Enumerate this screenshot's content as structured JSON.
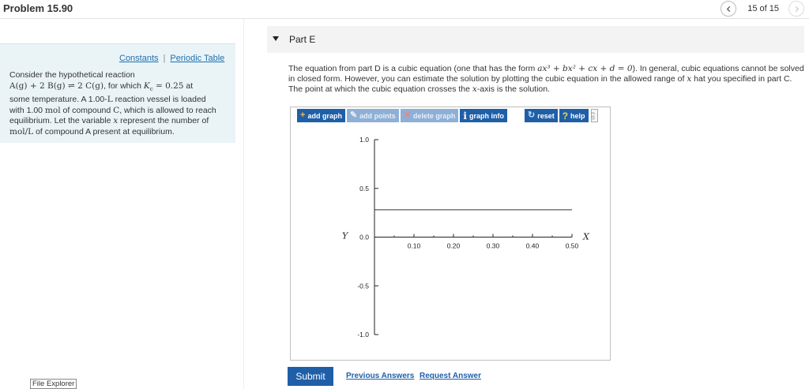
{
  "header": {
    "problem_title": "Problem 15.90",
    "page_count": "15 of 15"
  },
  "left": {
    "constants_link": "Constants",
    "separator": "|",
    "periodic_link": "Periodic Table",
    "text": {
      "line1": "Consider the hypothetical reaction",
      "reaction": "A(g) + 2 B(g) ⇌ 2 C(g)",
      "reaction_tail": ", for which ",
      "kc": "K",
      "kc_sub": "c",
      "kc_val": " = 0.25",
      "after_kc": " at",
      "s2": "some temperature. A 1.00-",
      "unit_L": "L",
      "s3": " reaction vessel is loaded",
      "s4": "with 1.00 ",
      "unit_mol": "mol",
      "s5": " of compound ",
      "comp_C": "C",
      "s6": ", which is allowed to reach",
      "s7": "equilibrium. Let the variable ",
      "var_x": "x",
      "s8": " represent the number of",
      "unit_molL": "mol/L",
      "s9": " of compound A present at equilibrium."
    }
  },
  "footer": {
    "file_explorer": "File Explorer"
  },
  "part": {
    "title": "Part E",
    "text": {
      "t1": "The equation from part D is a cubic equation (one that has the form ",
      "eq": "ax³ + bx² + cx + d = 0",
      "t2": "). In general, cubic equations cannot be solved in closed form. However, you can estimate the solution by plotting the cubic equation in the allowed range of ",
      "x1": "x",
      "t3": " hat you specified in part C. The point at which the cubic equation crosses the ",
      "x2": "x",
      "t4": "-axis is the solution."
    }
  },
  "toolbar": {
    "add_graph": "add graph",
    "add_points": "add points",
    "delete_graph": "delete graph",
    "graph_info": "graph info",
    "reset": "reset",
    "help": "help",
    "vert_label": "v3.3"
  },
  "chart_data": {
    "type": "line",
    "xlabel": "X",
    "ylabel": "Y",
    "xlim": [
      0,
      0.5
    ],
    "ylim": [
      -1.0,
      1.0
    ],
    "x_ticks": [
      "0.10",
      "0.20",
      "0.30",
      "0.40",
      "0.50"
    ],
    "x_tick_values": [
      0.1,
      0.2,
      0.3,
      0.4,
      0.5
    ],
    "y_ticks": [
      "1.0",
      "0.5",
      "0.0",
      "-0.5",
      "-1.0"
    ],
    "y_tick_values": [
      1.0,
      0.5,
      0.0,
      -0.5,
      -1.0
    ],
    "series": [
      {
        "x": [
          0,
          0.5
        ],
        "y": [
          0.28,
          0.28
        ],
        "color": "#333333"
      }
    ]
  },
  "actions": {
    "submit": "Submit",
    "previous_answers": "Previous Answers",
    "request_answer": "Request Answer"
  }
}
